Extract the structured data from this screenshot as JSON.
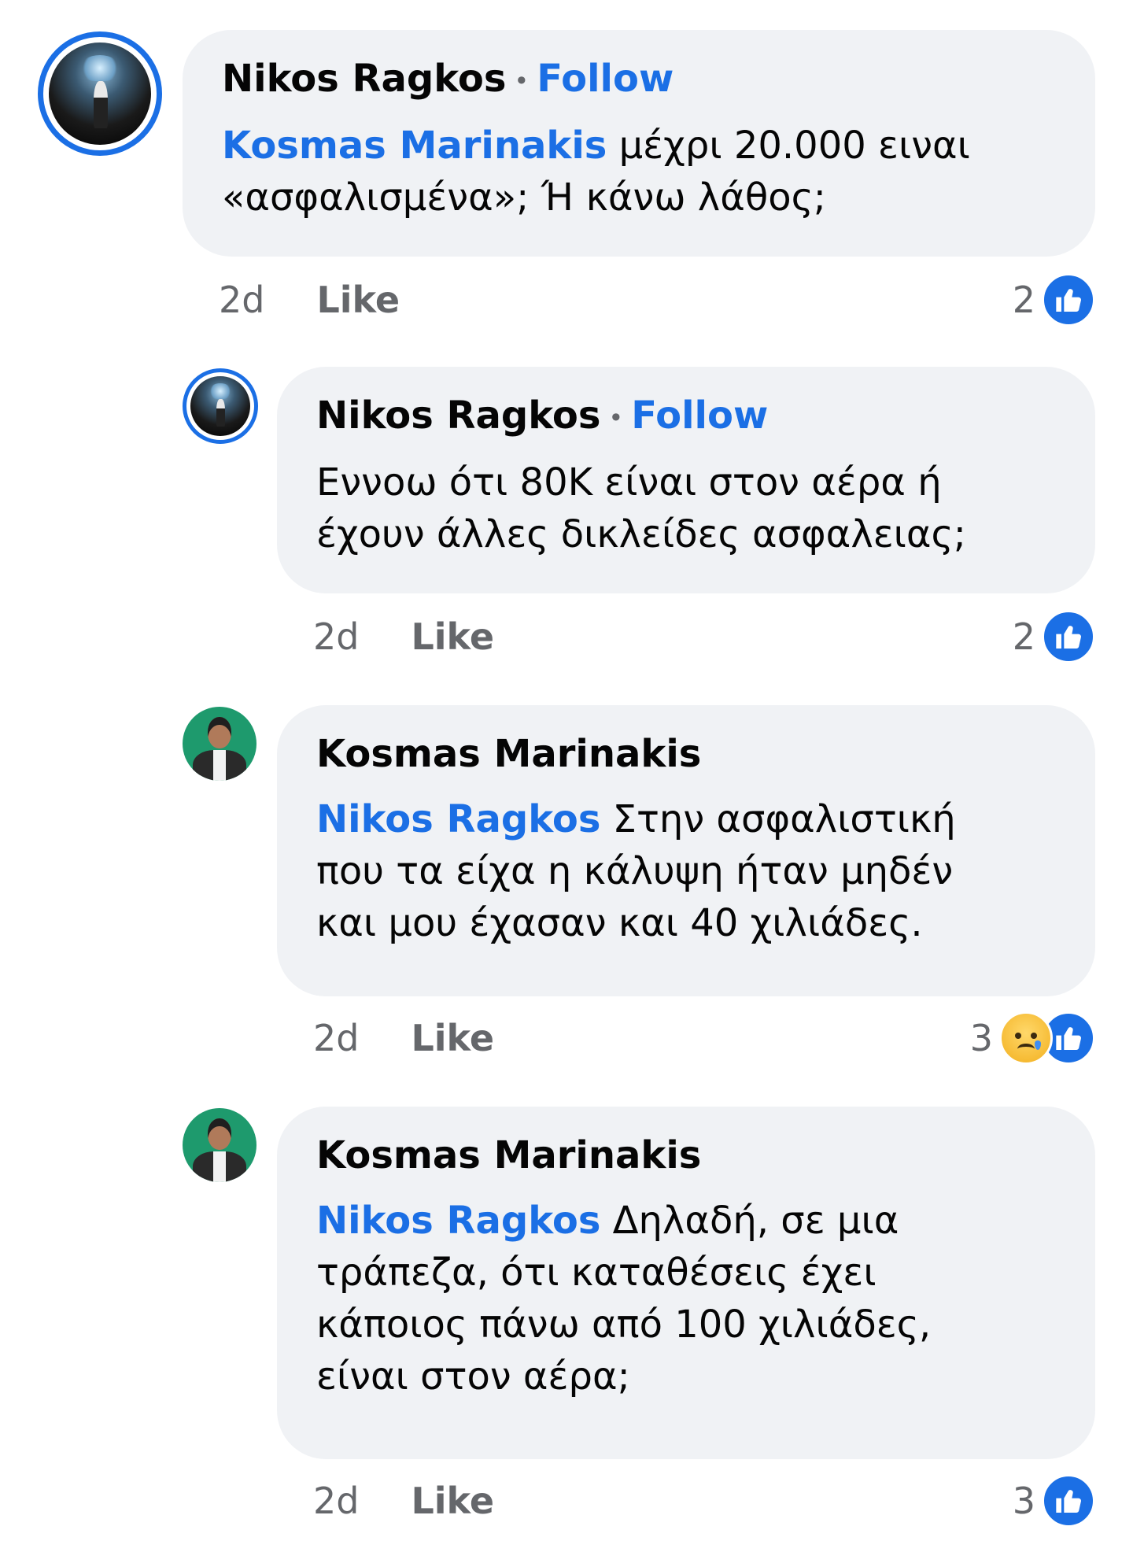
{
  "comments": [
    {
      "author": "Nikos Ragkos",
      "follow_label": "Follow",
      "mention": "Kosmas Marinakis",
      "lines": [
        "μέχρι 20.000 ειναι",
        "«ασφαλισμένα»; Ή κάνω λάθος;"
      ],
      "time": "2d",
      "like_label": "Like",
      "reaction_count": "2",
      "reactions": [
        "like-icon"
      ]
    },
    {
      "author": "Nikos Ragkos",
      "follow_label": "Follow",
      "mention": "",
      "lines": [
        "Εννοω ότι 80K είναι στον αέρα ή",
        "έχουν άλλες δικλείδες ασφαλειας;"
      ],
      "time": "2d",
      "like_label": "Like",
      "reaction_count": "2",
      "reactions": [
        "like-icon"
      ]
    },
    {
      "author": "Kosmas Marinakis",
      "mention": "Nikos Ragkos",
      "lines": [
        "Στην ασφαλιστική",
        "που τα είχα η κάλυψη ήταν μηδέν",
        "και μου έχασαν και 40 χιλιάδες."
      ],
      "time": "2d",
      "like_label": "Like",
      "reaction_count": "3",
      "reactions": [
        "sad-icon",
        "like-icon"
      ]
    },
    {
      "author": "Kosmas Marinakis",
      "mention": "Nikos Ragkos",
      "lines": [
        "Δηλαδή, σε μια",
        "τράπεζα, ότι καταθέσεις έχει",
        "κάποιος πάνω από 100 χιλιάδες,",
        "είναι στον αέρα;"
      ],
      "time": "2d",
      "like_label": "Like",
      "reaction_count": "3",
      "reactions": [
        "like-icon"
      ]
    }
  ],
  "colors": {
    "link": "#1b6fe5",
    "bubble": "#f0f2f5",
    "meta": "#65676b"
  }
}
